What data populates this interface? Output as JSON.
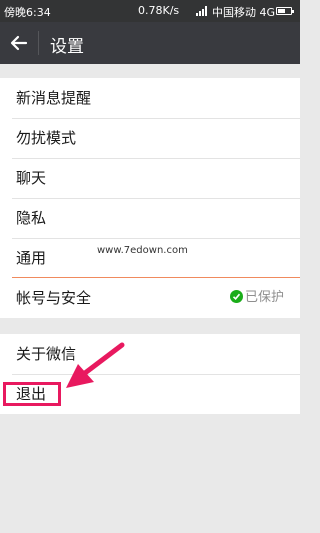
{
  "status_bar": {
    "time": "傍晚6:34",
    "network_speed": "0.78K/s",
    "carrier": "中国移动 4G",
    "battery_level": 0.6,
    "icons": [
      "signal-icon",
      "battery-icon"
    ]
  },
  "header": {
    "back_icon": "back-arrow-icon",
    "title": "设置"
  },
  "groups": [
    {
      "items": [
        {
          "label": "新消息提醒"
        },
        {
          "label": "勿扰模式"
        },
        {
          "label": "聊天"
        },
        {
          "label": "隐私"
        },
        {
          "label": "通用"
        },
        {
          "label": "帐号与安全",
          "status": "已保护",
          "status_icon": "shield-check-icon"
        }
      ]
    },
    {
      "items": [
        {
          "label": "关于微信"
        },
        {
          "label": "退出"
        }
      ]
    }
  ],
  "watermark": "www.7edown.com",
  "colors": {
    "status_bar": "#333435",
    "title_bar": "#393a3f",
    "background": "#e9e9e9",
    "protected_green": "#1aad19",
    "annotation_pink": "#e8195f",
    "divider_orange": "#f08a5d"
  }
}
